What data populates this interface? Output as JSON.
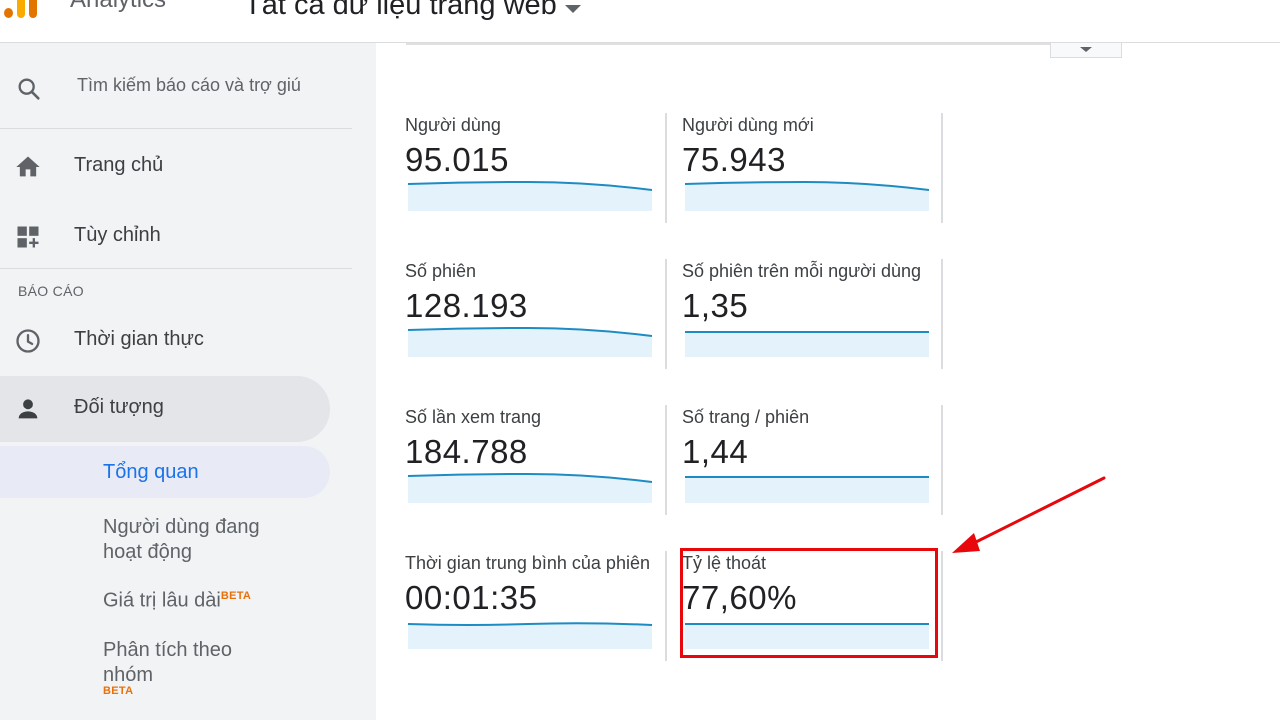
{
  "header": {
    "app_name": "Analytics",
    "account_selector": "Tất cả dữ liệu trang web"
  },
  "sidebar": {
    "search_placeholder": "Tìm kiếm báo cáo và trợ giú",
    "items": [
      {
        "label": "Trang chủ",
        "icon": "home-icon"
      },
      {
        "label": "Tùy chỉnh",
        "icon": "dashboard-customize-icon"
      }
    ],
    "section_label": "BÁO CÁO",
    "report_items": [
      {
        "label": "Thời gian thực",
        "icon": "clock-icon"
      },
      {
        "label": "Đối tượng",
        "icon": "person-icon",
        "active": true
      }
    ],
    "sub_items": [
      {
        "label": "Tổng quan",
        "selected": true
      },
      {
        "label": "Người dùng đang hoạt động"
      },
      {
        "label": "Giá trị lâu dài",
        "badge": "BETA"
      },
      {
        "label": "Phân tích theo nhóm",
        "badge": "BETA"
      }
    ]
  },
  "metrics": [
    {
      "label": "Người dùng",
      "value": "95.015"
    },
    {
      "label": "Người dùng mới",
      "value": "75.943"
    },
    {
      "label": "Số phiên",
      "value": "128.193"
    },
    {
      "label": "Số phiên trên mỗi người dùng",
      "value": "1,35"
    },
    {
      "label": "Số lần xem trang",
      "value": "184.788"
    },
    {
      "label": "Số trang / phiên",
      "value": "1,44"
    },
    {
      "label": "Thời gian trung bình của phiên",
      "value": "00:01:35"
    },
    {
      "label": "Tỷ lệ thoát",
      "value": "77,60%",
      "highlighted": true
    }
  ],
  "colors": {
    "accent": "#1a73e8",
    "sparkline": "#1e8bc3",
    "sparkline_fill": "#e3f2fb",
    "highlight": "#e8070b",
    "beta": "#e8710a"
  }
}
